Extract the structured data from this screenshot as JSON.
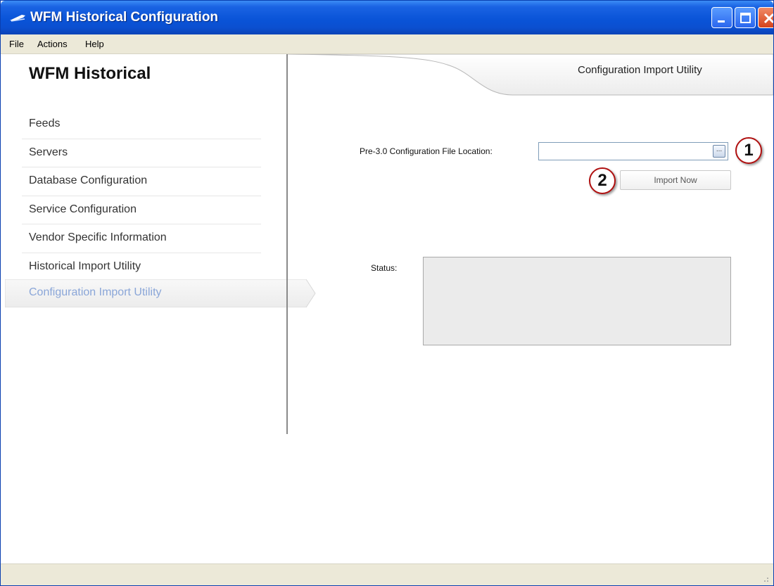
{
  "window": {
    "title": "WFM Historical Configuration",
    "icon": "app-icon"
  },
  "menu": {
    "file": "File",
    "actions": "Actions",
    "help": "Help"
  },
  "sidebar": {
    "heading": "WFM Historical",
    "items": [
      {
        "label": "Feeds"
      },
      {
        "label": "Servers"
      },
      {
        "label": "Database Configuration"
      },
      {
        "label": "Service Configuration"
      },
      {
        "label": "Vendor Specific Information"
      },
      {
        "label": "Historical Import Utility"
      }
    ],
    "selected": {
      "label": "Configuration Import Utility"
    }
  },
  "main": {
    "header_title": "Configuration Import Utility",
    "file_location_label": "Pre-3.0 Configuration File Location:",
    "file_location_value": "",
    "browse_label": "...",
    "import_button": "Import Now",
    "status_label": "Status:",
    "status_text": "",
    "callouts": [
      "1",
      "2"
    ]
  },
  "colors": {
    "titlebar": "#0a54d8",
    "selected_text": "#8aa6d8",
    "callout_border": "#b01010"
  }
}
